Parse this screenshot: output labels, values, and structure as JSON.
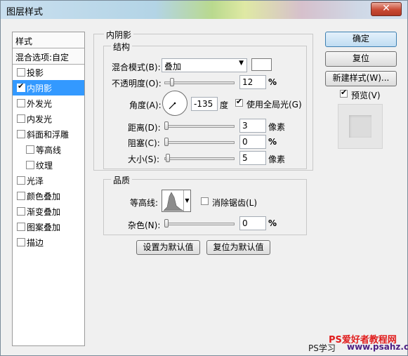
{
  "window": {
    "title": "图层样式",
    "close_glyph": "✕"
  },
  "left_panel": {
    "header": "样式",
    "blend_options": "混合选项:自定",
    "items": [
      {
        "label": "投影",
        "checked": false,
        "indent": false,
        "active": false
      },
      {
        "label": "内阴影",
        "checked": true,
        "indent": false,
        "active": true
      },
      {
        "label": "外发光",
        "checked": false,
        "indent": false,
        "active": false
      },
      {
        "label": "内发光",
        "checked": false,
        "indent": false,
        "active": false
      },
      {
        "label": "斜面和浮雕",
        "checked": false,
        "indent": false,
        "active": false
      },
      {
        "label": "等高线",
        "checked": false,
        "indent": true,
        "active": false
      },
      {
        "label": "纹理",
        "checked": false,
        "indent": true,
        "active": false
      },
      {
        "label": "光泽",
        "checked": false,
        "indent": false,
        "active": false
      },
      {
        "label": "颜色叠加",
        "checked": false,
        "indent": false,
        "active": false
      },
      {
        "label": "渐变叠加",
        "checked": false,
        "indent": false,
        "active": false
      },
      {
        "label": "图案叠加",
        "checked": false,
        "indent": false,
        "active": false
      },
      {
        "label": "描边",
        "checked": false,
        "indent": false,
        "active": false
      }
    ]
  },
  "inner_shadow": {
    "title": "内阴影",
    "structure": {
      "title": "结构",
      "blend_mode_label": "混合模式(B):",
      "blend_mode_value": "叠加",
      "opacity_label": "不透明度(O):",
      "opacity_value": "12",
      "opacity_unit": "%",
      "angle_label": "角度(A):",
      "angle_value": "-135",
      "angle_unit": "度",
      "global_light_label": "使用全局光(G)",
      "global_light_checked": true,
      "distance_label": "距离(D):",
      "distance_value": "3",
      "distance_unit": "像素",
      "choke_label": "阻塞(C):",
      "choke_value": "0",
      "choke_unit": "%",
      "size_label": "大小(S):",
      "size_value": "5",
      "size_unit": "像素"
    },
    "quality": {
      "title": "品质",
      "contour_label": "等高线:",
      "anti_alias_label": "消除锯齿(L)",
      "anti_alias_checked": false,
      "noise_label": "杂色(N):",
      "noise_value": "0",
      "noise_unit": "%"
    },
    "set_default_button": "设置为默认值",
    "reset_default_button": "复位为默认值"
  },
  "right_panel": {
    "ok_button": "确定",
    "reset_button": "复位",
    "new_style_button": "新建样式(W)...",
    "preview_label": "预览(V)",
    "preview_checked": true
  },
  "watermark": {
    "line1": "PS爱好者教程网",
    "line2": "PS学习",
    "line3": "www.psahz.com"
  },
  "colors": {
    "accent_selected": "#3399ff",
    "shadow_color_swatch": "#ffffff",
    "watermark_red": "#e01c1c",
    "watermark_purple": "#4d1e82"
  }
}
